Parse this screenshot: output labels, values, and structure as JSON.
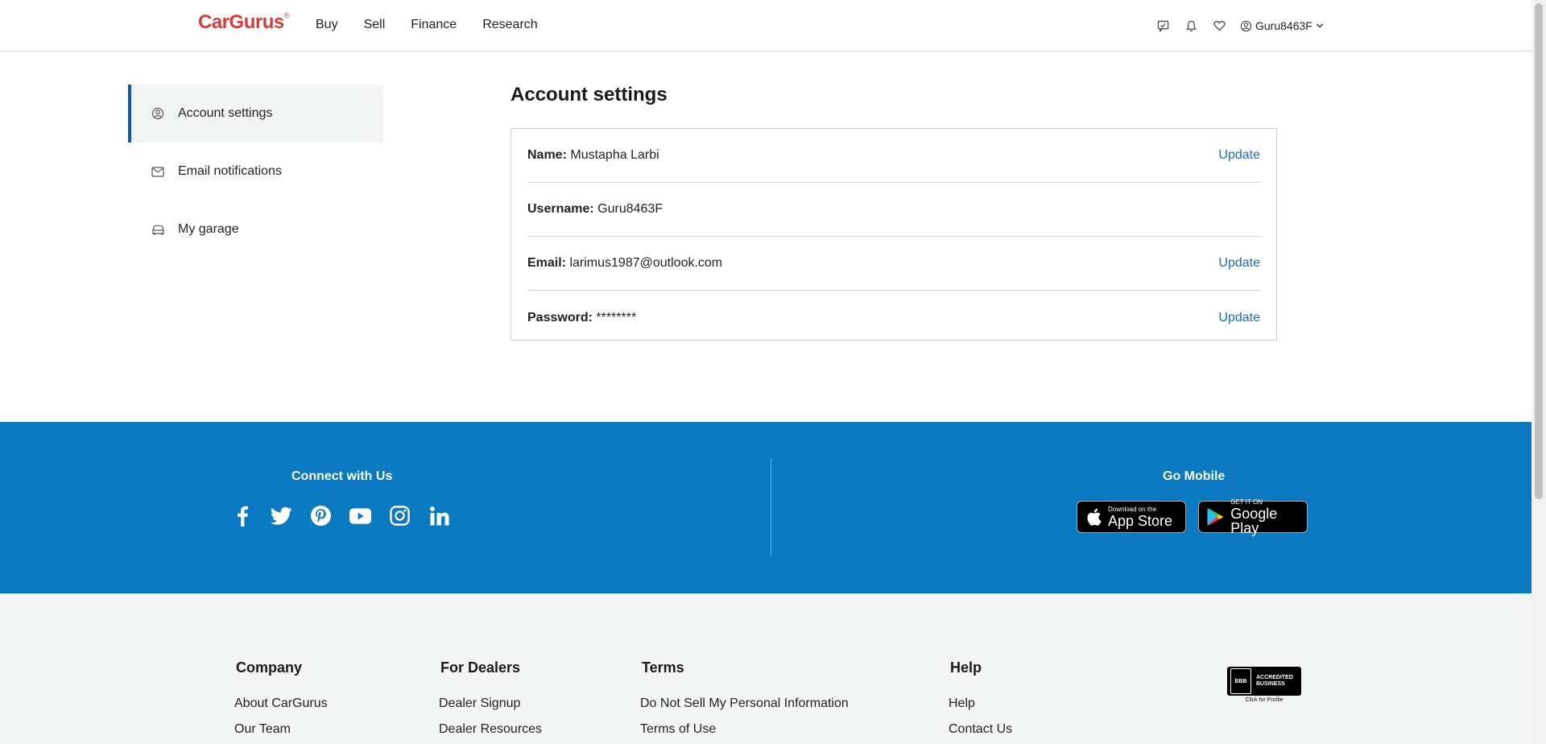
{
  "header": {
    "logo_car": "Car",
    "logo_gurus": "Gurus",
    "logo_reg": "®",
    "nav": [
      "Buy",
      "Sell",
      "Finance",
      "Research"
    ],
    "username": "Guru8463F"
  },
  "sidebar": {
    "items": [
      {
        "label": "Account settings",
        "icon": "user-circle-icon",
        "active": true
      },
      {
        "label": "Email notifications",
        "icon": "envelope-icon",
        "active": false
      },
      {
        "label": "My garage",
        "icon": "car-icon",
        "active": false
      }
    ]
  },
  "main": {
    "title": "Account settings",
    "rows": [
      {
        "label": "Name:",
        "value": "Mustapha Larbi",
        "action": "Update"
      },
      {
        "label": "Username:",
        "value": "Guru8463F",
        "action": ""
      },
      {
        "label": "Email:",
        "value": "larimus1987@outlook.com",
        "action": "Update"
      },
      {
        "label": "Password:",
        "value": "********",
        "action": "Update"
      }
    ]
  },
  "band": {
    "connect_heading": "Connect with Us",
    "mobile_heading": "Go Mobile",
    "social_icons": [
      "facebook-icon",
      "twitter-icon",
      "pinterest-icon",
      "youtube-icon",
      "instagram-icon",
      "linkedin-icon"
    ],
    "app_store": {
      "small": "Download on the",
      "big": "App Store"
    },
    "google_play": {
      "small": "GET IT ON",
      "big": "Google Play"
    },
    "color": "#0a79c1"
  },
  "footer": {
    "columns": [
      {
        "heading": "Company",
        "links": [
          "About CarGurus",
          "Our Team"
        ]
      },
      {
        "heading": "For Dealers",
        "links": [
          "Dealer Signup",
          "Dealer Resources"
        ]
      },
      {
        "heading": "Terms",
        "links": [
          "Do Not Sell My Personal Information",
          "Terms of Use"
        ]
      },
      {
        "heading": "Help",
        "links": [
          "Help",
          "Contact Us"
        ]
      }
    ],
    "bbb": {
      "seal": "BBB",
      "line1": "ACCREDITED",
      "line2": "BUSINESS",
      "caption": "Click for Profile"
    }
  },
  "colors": {
    "accent": "#0f5aa8",
    "link": "#1d6bb5",
    "brand_red": "#d63b3b"
  }
}
